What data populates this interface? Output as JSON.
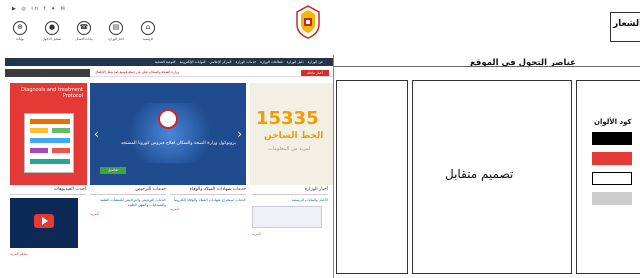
{
  "header": {
    "social_icons": [
      "youtube-icon",
      "instagram-icon",
      "linkedin-icon",
      "facebook-icon",
      "twitter-icon",
      "email-icon"
    ],
    "quick_links": [
      {
        "label": "الرئيسية",
        "icon": "home-icon"
      },
      {
        "label": "أخبار الوزارة",
        "icon": "news-icon"
      },
      {
        "label": "بيانات الاتصال",
        "icon": "phone-icon"
      },
      {
        "label": "تسجيل الدخول",
        "icon": "user-icon"
      },
      {
        "label": "بوابات",
        "icon": "link-icon"
      }
    ],
    "top_right_label": "الشعار"
  },
  "site": {
    "nav_items": [
      "عن الوزارة",
      "دليل الوزارة",
      "قطاعات الوزارة",
      "خدمات الوزارة",
      "المركز الإعلامي",
      "البوابات الإلكترونية",
      "التوعية الصحية"
    ],
    "ticker_badge": "أخبار عاجلة",
    "ticker_text": "وزارة الصحة والسكان تعلن عن حملة قومية ضد شلل الأطفال",
    "book_title": "Diagnosis and treatment Protocol",
    "slider_caption": "بروتوكول وزارة الصحة والسكان لعلاج فيروس كورونا المستجد",
    "slider_button": "تفاصيل",
    "hotline_number": "15335",
    "hotline_label": "الخط الساخن",
    "hotline_more": "لمزيد من المعلومات",
    "columns": [
      {
        "heading": "أحدث الفيديوهات",
        "link": "شاهد المزيد"
      },
      {
        "heading": "خدمات الترخيص",
        "body": "خدمات الترخيص والتراخيص للمنشآت الطبية والصيدليات والمهن الطبية",
        "link": "المزيد"
      },
      {
        "heading": "خدمات شهادات الميلاد والوفاة",
        "body": "خدمات استخراج شهادات الميلاد والوفاة إلكترونياً",
        "link": "المزيد"
      },
      {
        "heading": "أخبار الوزارة",
        "body": "الأخبار والبيانات الرسمية",
        "link": "المزيد"
      }
    ]
  },
  "design": {
    "header_text": "عناصر التجول في الموقع",
    "center_label": "تصميم متقابل",
    "color_code_title": "كود الألوان",
    "swatches": [
      "#000000",
      "#e53935",
      "#ffffff",
      "#cccccc"
    ]
  }
}
